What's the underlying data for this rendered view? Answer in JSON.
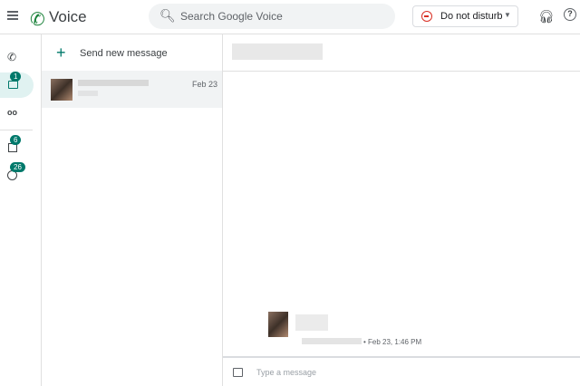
{
  "header": {
    "app_title": "Voice",
    "search_placeholder": "Search Google Voice",
    "dnd_label": "Do not disturb"
  },
  "nav": {
    "messages_badge": "1",
    "voicemail_badge": "6",
    "spam_badge": "26"
  },
  "list": {
    "send_new": "Send new message",
    "conversations": [
      {
        "date": "Feb 23"
      }
    ]
  },
  "chat": {
    "message_time": "• Feb 23, 1:46 PM",
    "compose_placeholder": "Type a message"
  },
  "colors": {
    "accent": "#00796b",
    "dnd": "#d93025"
  }
}
